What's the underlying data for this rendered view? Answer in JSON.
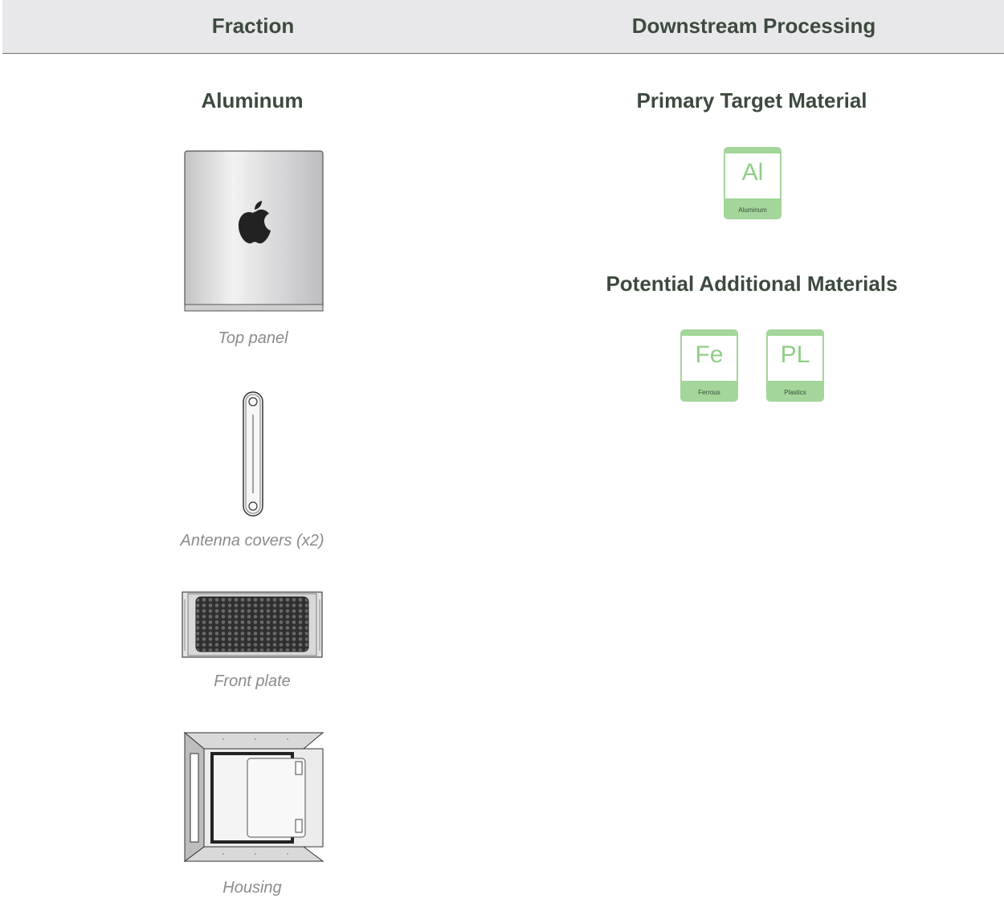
{
  "header": {
    "fraction": "Fraction",
    "downstream": "Downstream Processing"
  },
  "fraction": {
    "title": "Aluminum",
    "items": [
      {
        "caption": "Top panel"
      },
      {
        "caption": "Antenna covers (x2)"
      },
      {
        "caption": "Front plate"
      },
      {
        "caption": "Housing"
      }
    ]
  },
  "processing": {
    "primary_title": "Primary Target Material",
    "primary": [
      {
        "symbol": "Al",
        "name": "Aluminum"
      }
    ],
    "additional_title": "Potential Additional Materials",
    "additional": [
      {
        "symbol": "Fe",
        "name": "Ferrous"
      },
      {
        "symbol": "PL",
        "name": "Plastics"
      }
    ]
  },
  "colors": {
    "badge_green": "#a4d59a",
    "heading": "#3d4a3f",
    "header_bg": "#e8e8ea",
    "caption": "#8b8b8b"
  },
  "icons": [
    "apple-logo-icon"
  ]
}
